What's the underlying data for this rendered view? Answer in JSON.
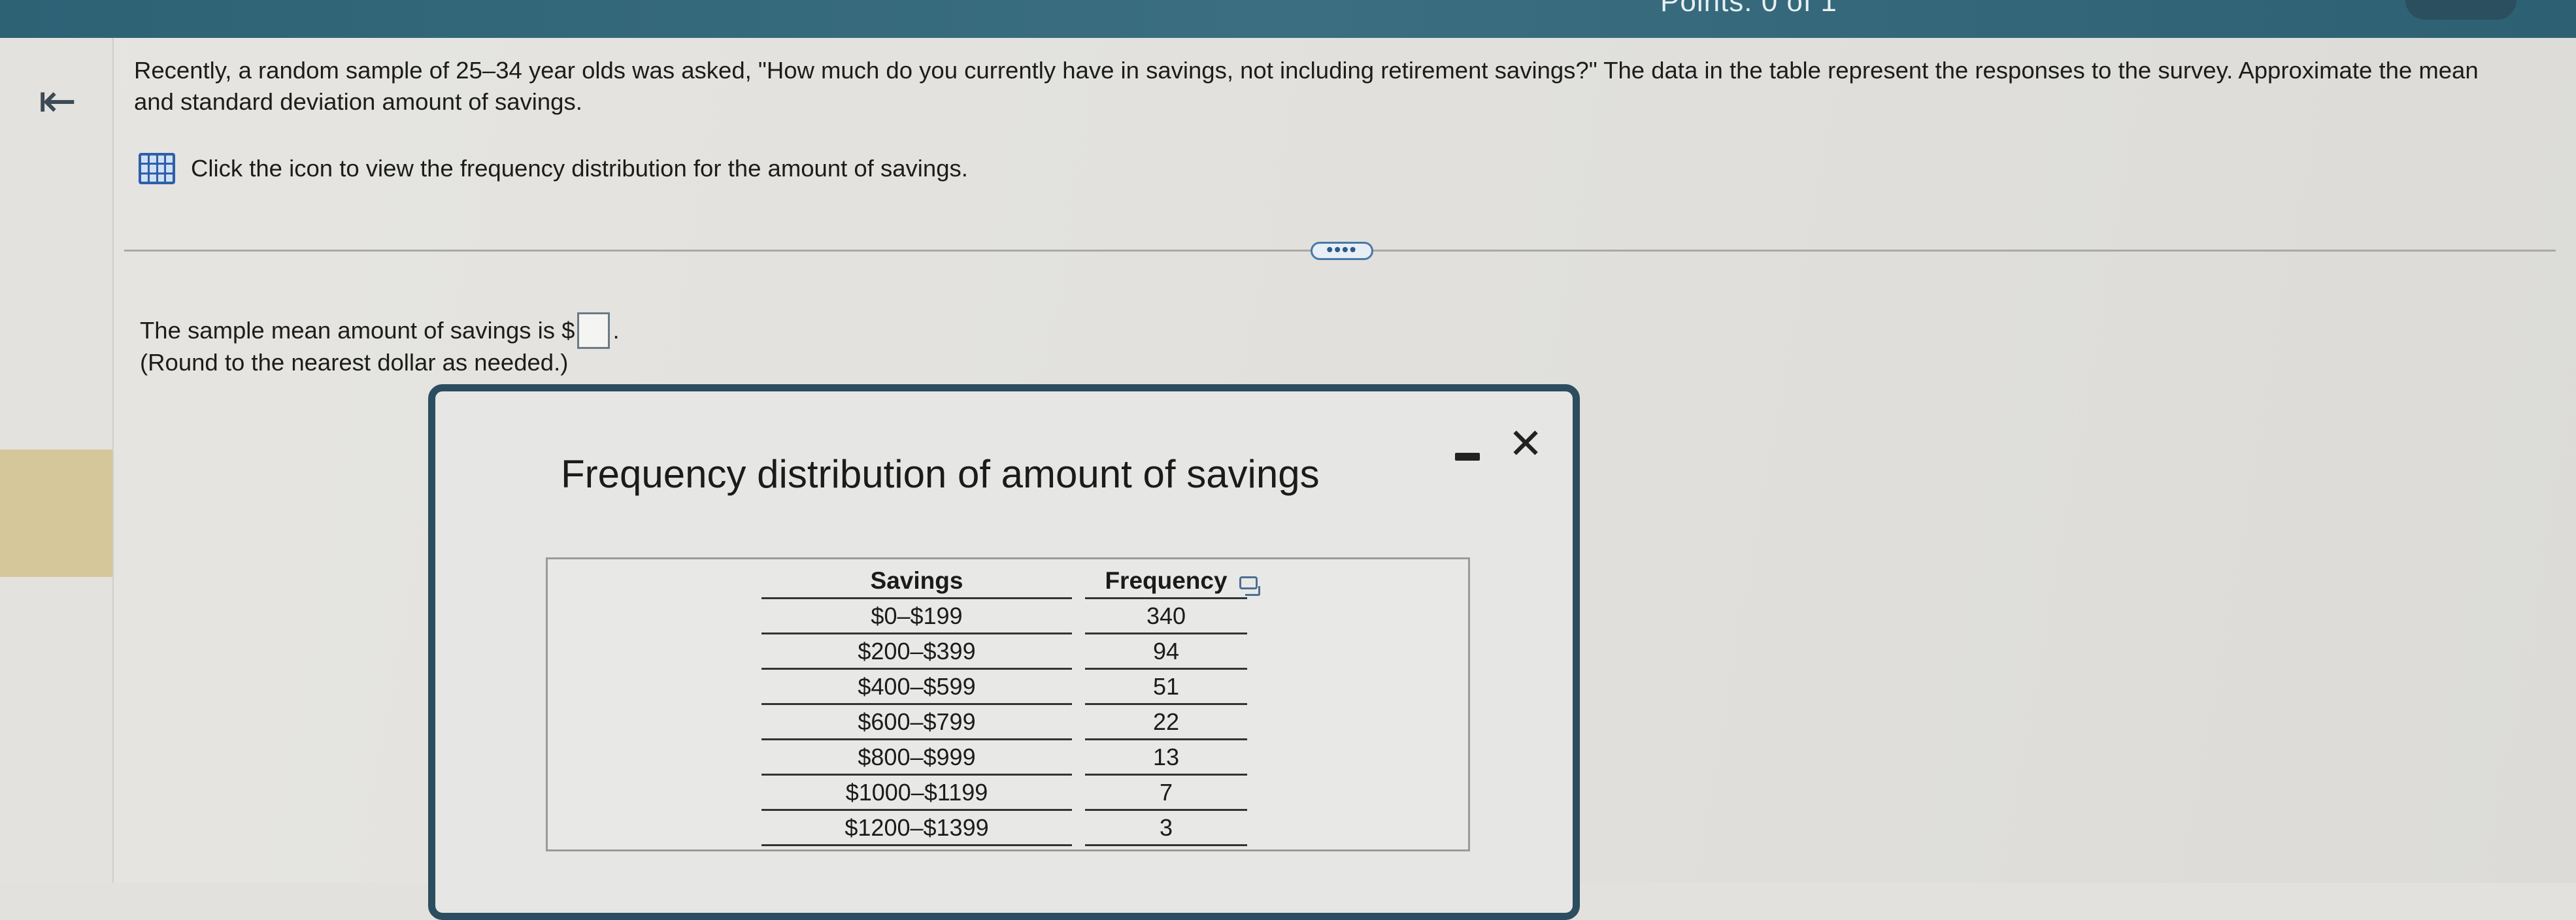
{
  "header": {
    "points_text": "Points: 0 of 1"
  },
  "nav": {
    "back_icon": "arrow-left-to-bar-icon"
  },
  "question": {
    "text": "Recently, a random sample of 25–34 year olds was asked, \"How much do you currently have in savings, not including retirement savings?\" The data in the table represent the responses to the survey. Approximate the mean and standard deviation amount of savings.",
    "table_link_text": "Click the icon to view the frequency distribution for the amount of savings.",
    "table_icon": "table-grid-icon"
  },
  "more_button": {
    "label": "••••"
  },
  "answer": {
    "prefix": "The sample mean amount of savings is $",
    "suffix": ".",
    "input_value": "",
    "note": "(Round to the nearest dollar as needed.)"
  },
  "dialog": {
    "title": "Frequency distribution of amount of savings",
    "minimize_icon": "minimize-icon",
    "close_icon": "close-icon",
    "close_glyph": "✕",
    "copy_icon": "copy-icon",
    "table": {
      "headers": [
        "Savings",
        "Frequency"
      ],
      "rows": [
        [
          "$0–$199",
          "340"
        ],
        [
          "$200–$399",
          "94"
        ],
        [
          "$400–$599",
          "51"
        ],
        [
          "$600–$799",
          "22"
        ],
        [
          "$800–$999",
          "13"
        ],
        [
          "$1000–$1199",
          "7"
        ],
        [
          "$1200–$1399",
          "3"
        ]
      ]
    }
  },
  "colors": {
    "top_bar": "#2d6275",
    "dialog_border": "#2b4d5f",
    "table_icon": "#2f5fa8",
    "left_highlight": "#d6c79a"
  }
}
